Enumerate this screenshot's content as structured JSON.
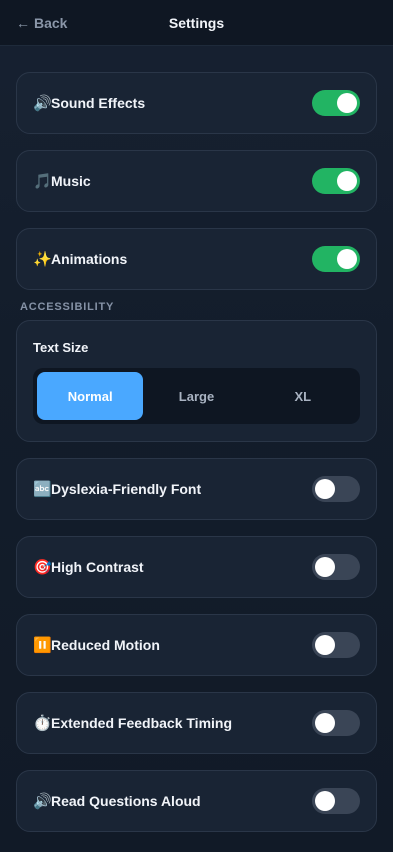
{
  "header": {
    "back_label": "Back",
    "title": "Settings"
  },
  "settings_top": [
    {
      "icon": "🔊",
      "icon_name": "speaker-icon",
      "label": "Sound Effects",
      "enabled": true
    },
    {
      "icon": "🎵",
      "icon_name": "music-note-icon",
      "label": "Music",
      "enabled": true
    },
    {
      "icon": "✨",
      "icon_name": "sparkles-icon",
      "label": "Animations",
      "enabled": true
    }
  ],
  "accessibility": {
    "section_label": "ACCESSIBILITY",
    "text_size": {
      "title": "Text Size",
      "options": [
        "Normal",
        "Large",
        "XL"
      ],
      "selected": "Normal"
    },
    "items": [
      {
        "icon": "🔤",
        "icon_name": "abc-icon",
        "label": "Dyslexia-Friendly Font",
        "enabled": false
      },
      {
        "icon": "🎯",
        "icon_name": "target-icon",
        "label": "High Contrast",
        "enabled": false
      },
      {
        "icon": "⏸️",
        "icon_name": "pause-icon",
        "label": "Reduced Motion",
        "enabled": false
      },
      {
        "icon": "⏱️",
        "icon_name": "stopwatch-icon",
        "label": "Extended Feedback Timing",
        "enabled": false
      },
      {
        "icon": "🔊",
        "icon_name": "speaker-icon",
        "label": "Read Questions Aloud",
        "enabled": false
      }
    ]
  },
  "colors": {
    "toggle_on": "#22b463",
    "toggle_off": "#3a4556",
    "segment_active": "#4aa8ff",
    "background": "#131d2b"
  }
}
